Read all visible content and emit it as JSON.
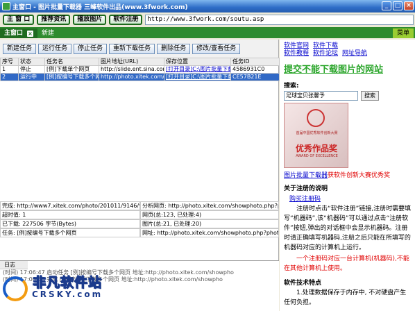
{
  "window": {
    "title": "主窗口 - 图片批量下载器 三峰软件出品(www.3fwork.com)",
    "min": "_",
    "max": "□",
    "close": "×"
  },
  "toolbar": {
    "buttons": [
      "主 窗 口",
      "推荐资讯",
      "播放图片",
      "软件注册"
    ],
    "url": "http://www.3fwork.com/soutu.asp"
  },
  "tabs": {
    "active": "主窗口",
    "close": "×",
    "new": "新建",
    "menu": "菜单"
  },
  "actions": [
    "新建任务",
    "运行任务",
    "停止任务",
    "重新下载任务",
    "删除任务",
    "修改/查看任务"
  ],
  "table": {
    "headers": [
      "序号",
      "状态",
      "任务名",
      "图片地址(URL)",
      "保存位置",
      "任务ID"
    ],
    "rows": [
      [
        "1",
        "停止",
        "[例]下载单个网页",
        "http://slide.ent.sina.com",
        "[打开目录]C:\\图片批量下载器\\",
        "4586931C0"
      ],
      [
        "2",
        "运行中",
        "[例]按编号下载多个网页",
        "http://photo.xitek.com/sl",
        "[打开目录]C:\\图片批量下载器\\",
        "CE57B21E"
      ]
    ]
  },
  "info": {
    "done": "完成: http://www7.xitek.com/photo/201011/9146/914616",
    "analyze": "分析网页: http://photo.xitek.com/showphoto.php?photoid",
    "timeout": "超时值: 1",
    "pages": "网页(总:123, 已处理:4)",
    "downloaded": "已下载: 227506 字节(Bytes)",
    "images": "图片(总:21, 已处理:20)",
    "task": "任务: [例]按编号下载多个网页",
    "address": "网址: http://photo.xitek.com/showphoto.php?photoid=9"
  },
  "log": {
    "label": "日志",
    "lines": [
      "(时间) 17:06:47  启动任务 [例]按编号下载多个网页 地址:http://photo.xitek.com/showpho",
      "(时间) 17:06:50  完成 [例]按编号下载多个网页 地址:http://photo.xitek.com/showpho"
    ]
  },
  "watermark": {
    "cn": "非凡软件站",
    "en": "CRSKY.com"
  },
  "right": {
    "links_row1": [
      "软件官网",
      "软件下载"
    ],
    "links_row2": [
      "软件教程",
      "软件论坛",
      "网址导航"
    ],
    "headline": "提交不能下载图片的网站",
    "search_label": "搜索:",
    "search_value": "足球宝贝张馨予",
    "search_button": "搜索",
    "photo_title": "首届中国优秀软件创新大赛",
    "photo_big": "优秀作品奖",
    "photo_sub": "AWARD OF EXCELLENCE",
    "caption_link": "图片批量下载器",
    "caption_text": "获软件创新大赛优秀奖",
    "reg_heading": "关于注册的说明",
    "reg_link": "购买注册码",
    "reg_para": "注册时点击“软件注册”链接,注册时需要填写“机器码”,该“机器码”可以通过点击“注册软件”按钮,弹出的对话框中会显示机器码。注册时请正确填写机器码,注册之后只能在所填写的机器码对应的计算机上运行。",
    "reg_red": "一个注册码对应一台计算机(机器码),不能在其他计算机上使用。",
    "feat_heading": "软件技术特点",
    "feat_para": "1.处理数据保存于内存中, 不对硬盘产生任何负担。"
  }
}
